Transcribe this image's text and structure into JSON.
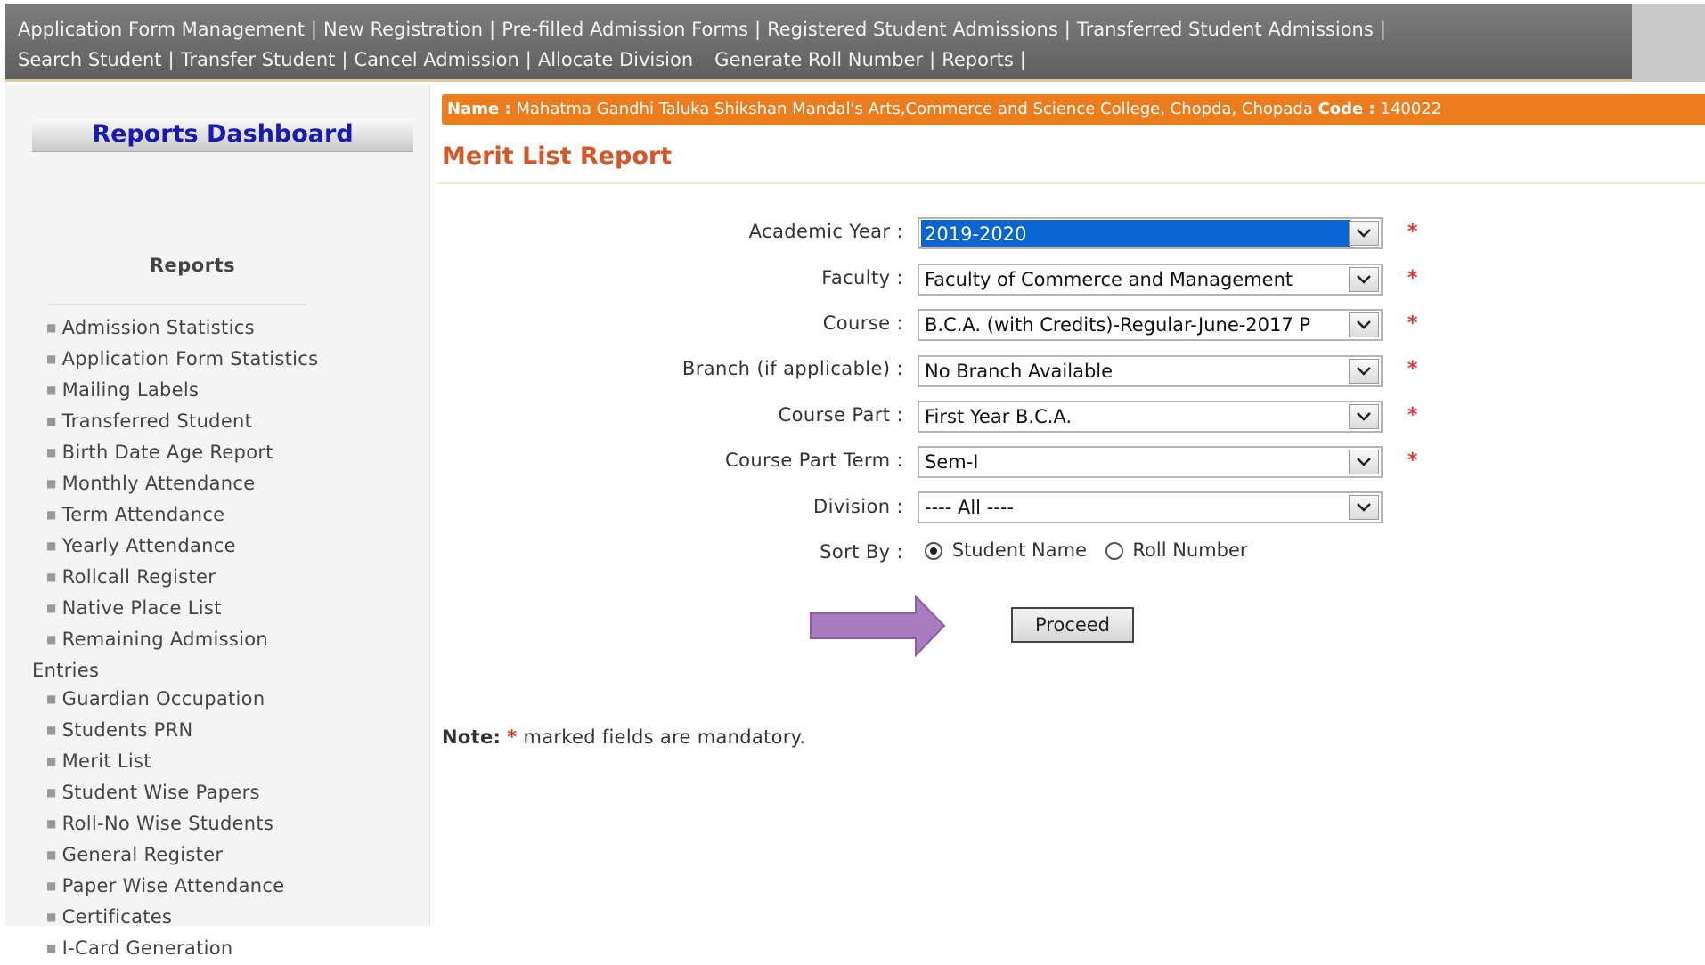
{
  "topnav": {
    "row1": [
      "Application Form Management",
      "New Registration",
      "Pre-filled Admission Forms",
      "Registered Student Admissions",
      "Transferred Student Admissions"
    ],
    "row2": [
      "Search Student",
      "Transfer Student",
      "Cancel Admission",
      "Allocate Division",
      "Generate Roll Number",
      "Reports"
    ]
  },
  "sidebar": {
    "title": "Reports Dashboard",
    "heading": "Reports",
    "items": [
      "Admission Statistics",
      "Application Form Statistics",
      "Mailing Labels",
      "Transferred Student",
      "Birth Date Age Report",
      "Monthly Attendance",
      "Term Attendance",
      "Yearly Attendance",
      "Rollcall Register",
      "Native Place List",
      "Remaining Admission",
      "Entries",
      "Guardian Occupation",
      "Students PRN",
      "Merit List",
      "Student Wise Papers",
      "Roll-No Wise Students",
      "General Register",
      "Paper Wise Attendance",
      "Certificates",
      "I-Card Generation"
    ]
  },
  "infobar": {
    "name_label": "Name :",
    "name_value": "Mahatma Gandhi Taluka Shikshan Mandal's Arts,Commerce and Science College, Chopda, Chopada",
    "code_label": "Code :",
    "code_value": "140022"
  },
  "page_title": "Merit List Report",
  "form": {
    "academic_year": {
      "label": "Academic Year :",
      "value": "2019-2020"
    },
    "faculty": {
      "label": "Faculty :",
      "value": "Faculty of Commerce and Management"
    },
    "course": {
      "label": "Course :",
      "value": "B.C.A. (with Credits)-Regular-June-2017 P"
    },
    "branch": {
      "label": "Branch (if applicable) :",
      "value": "No Branch Available"
    },
    "course_part": {
      "label": "Course Part :",
      "value": "First Year B.C.A."
    },
    "course_part_term": {
      "label": "Course Part Term :",
      "value": "Sem-I"
    },
    "division": {
      "label": "Division :",
      "value": "---- All ----"
    },
    "sort_by": {
      "label": "Sort By :",
      "option1": "Student Name",
      "option2": "Roll Number",
      "selected": "Student Name"
    },
    "required_mark": "*",
    "proceed_label": "Proceed"
  },
  "note": {
    "label": "Note:",
    "star": "*",
    "text": "marked fields are mandatory."
  },
  "colors": {
    "accent_orange": "#ec7d1e",
    "title_color": "#d2582a",
    "dashboard_blue": "#1a1ab0",
    "arrow_purple": "#a97bbf",
    "required_red": "#e03838"
  }
}
